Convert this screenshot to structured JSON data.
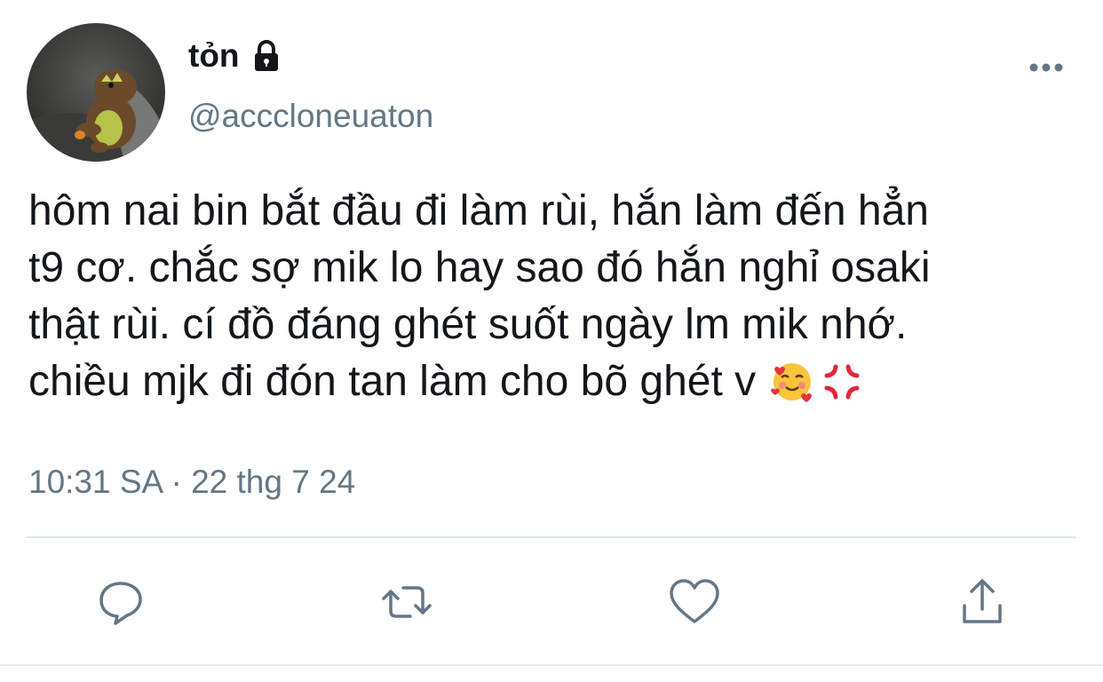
{
  "tweet": {
    "display_name": "tỏn",
    "handle": "@acccloneuaton",
    "locked_icon": "lock-icon",
    "text_lines": [
      "hôm nai bin bắt đầu đi làm rùi, hắn làm đến hẳn",
      "t9 cơ. chắc sợ mik lo hay sao đó hắn nghỉ osaki",
      "thật rùi. cí đồ đáng ghét suốt ngày lm mik nhớ.",
      "chiều mjk đi đón tan làm cho bõ ghét v"
    ],
    "emojis": [
      "smiling-face-with-hearts-icon",
      "anger-symbol-icon"
    ],
    "timestamp": "10:31 SA · 22 thg 7 24"
  },
  "actions": {
    "reply_icon": "reply-icon",
    "retweet_icon": "retweet-icon",
    "like_icon": "heart-icon",
    "share_icon": "share-icon"
  },
  "colors": {
    "primary_text": "#14171a",
    "secondary_text": "#657786",
    "divider": "#e1e8ed"
  }
}
